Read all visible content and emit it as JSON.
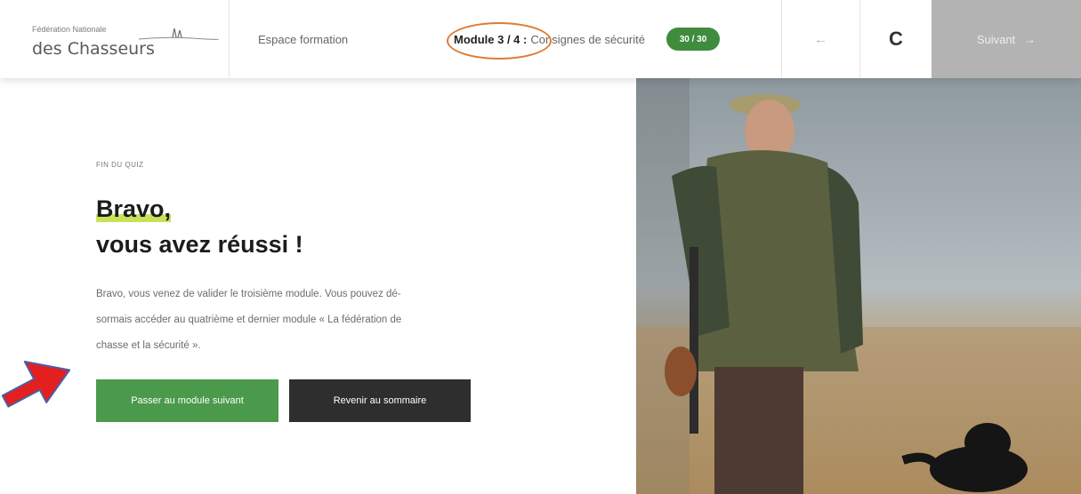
{
  "header": {
    "logo_small": "Fédération Nationale",
    "logo_big": "des Chasseurs",
    "nav_link": "Espace formation",
    "module_label": "Module 3 / 4 :",
    "module_name": "Consignes de sécurité",
    "score": "30 / 30",
    "prev_icon": "←",
    "reload_icon": "C",
    "next_label": "Suivant",
    "next_icon": "→"
  },
  "content": {
    "eyebrow": "FIN DU QUIZ",
    "title_line1": "Bravo,",
    "title_line2": "vous avez réussi !",
    "body_line1": "Bravo, vous venez de valider le troisième module. Vous pouvez dé-",
    "body_line2": "sormais accéder au quatrième et dernier module « La fédération de",
    "body_line3": "chasse et la sécurité ».",
    "primary_button": "Passer au module suivant",
    "secondary_button": "Revenir au sommaire"
  },
  "colors": {
    "accent_green": "#4b9a4b",
    "highlight": "#c7e25a",
    "annotation_orange": "#e07b35",
    "annotation_red": "#e41f1f"
  },
  "icons": [
    "arrow-left-icon",
    "reload-icon",
    "arrow-right-icon",
    "annotation-arrow-icon"
  ]
}
